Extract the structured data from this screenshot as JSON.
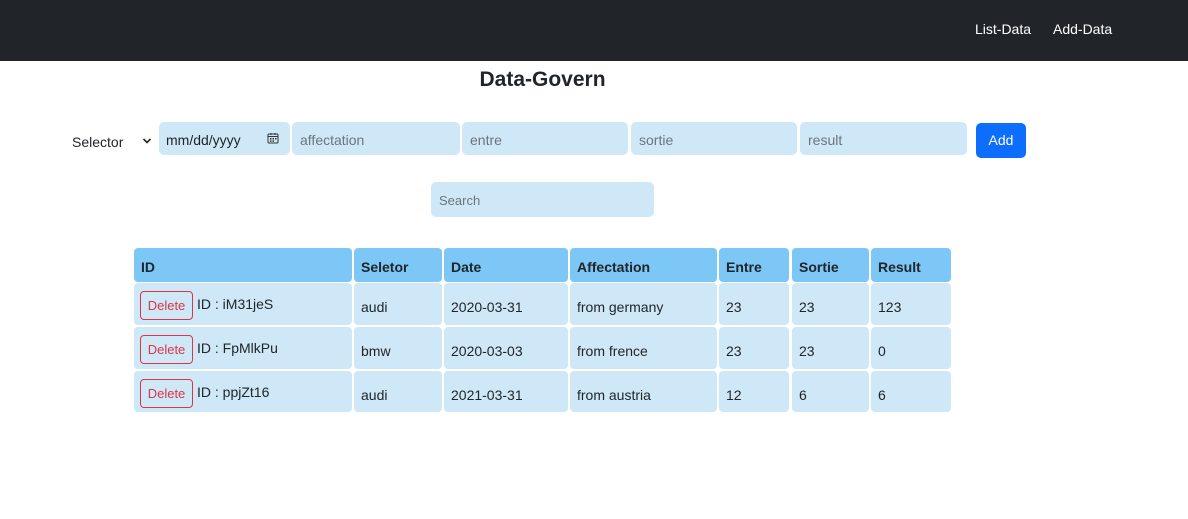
{
  "navbar": {
    "links": [
      "List-Data",
      "Add-Data"
    ]
  },
  "title": "Data-Govern",
  "form": {
    "selector_label": "Selector",
    "date_value": "mm/dd/yyyy",
    "affectation_placeholder": "affectation",
    "entre_placeholder": "entre",
    "sortie_placeholder": "sortie",
    "result_placeholder": "result",
    "add_label": "Add"
  },
  "search": {
    "placeholder": "Search"
  },
  "table": {
    "headers": [
      "ID",
      "Seletor",
      "Date",
      "Affectation",
      "Entre",
      "Sortie",
      "Result"
    ],
    "delete_label": "Delete",
    "rows": [
      {
        "id": "ID : iM31jeS",
        "selector": "audi",
        "date": "2020-03-31",
        "affectation": "from germany",
        "entre": "23",
        "sortie": "23",
        "result": "123"
      },
      {
        "id": "ID : FpMlkPu",
        "selector": "bmw",
        "date": "2020-03-03",
        "affectation": "from frence",
        "entre": "23",
        "sortie": "23",
        "result": "0"
      },
      {
        "id": "ID : ppjZt16",
        "selector": "audi",
        "date": "2021-03-31",
        "affectation": "from austria",
        "entre": "12",
        "sortie": "6",
        "result": "6"
      }
    ]
  },
  "colors": {
    "navbar": "#212529",
    "primary": "#0d6efd",
    "danger": "#dc3545",
    "header": "#7cc7f5",
    "cell": "#cfe8f8"
  }
}
